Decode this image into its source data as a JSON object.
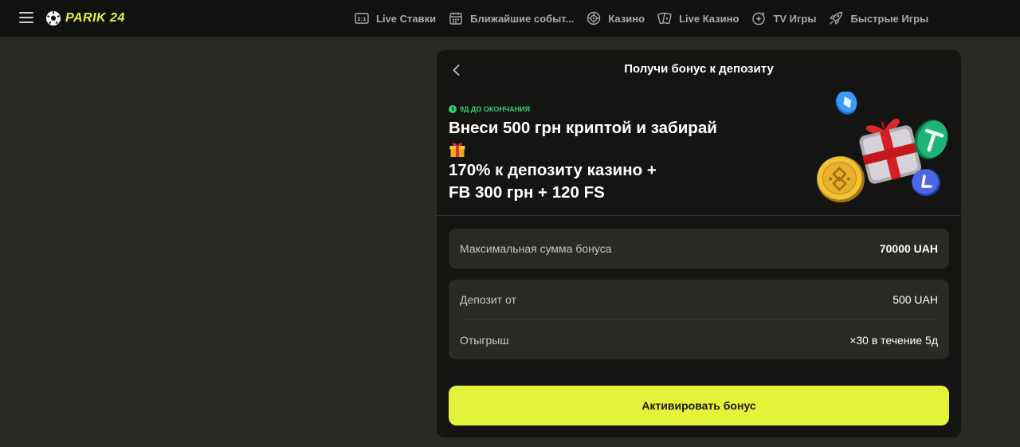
{
  "header": {
    "logo_text": "PARIK 24",
    "nav": [
      {
        "label": "Live Ставки",
        "icon": "live-bets-icon"
      },
      {
        "label": "Ближайшие событ...",
        "icon": "calendar-icon"
      },
      {
        "label": "Казино",
        "icon": "roulette-icon"
      },
      {
        "label": "Live Казино",
        "icon": "cards-icon"
      },
      {
        "label": "TV Игры",
        "icon": "tv-games-icon"
      },
      {
        "label": "Быстрые Игры",
        "icon": "rocket-icon"
      }
    ]
  },
  "panel": {
    "title": "Получи бонус к депозиту",
    "deadline": "9Д ДО ОКОНЧАНИЯ",
    "promo_line1": "Внеси 500 грн криптой и забирай",
    "promo_line2": "170% к депозиту казино +",
    "promo_line3": "FB 300 грн + 120 FS",
    "max_bonus": {
      "label": "Максимальная сумма бонуса",
      "value": "70000 UAH"
    },
    "deposit": {
      "label": "Депозит от",
      "value": "500 UAH"
    },
    "wager": {
      "label": "Отыгрыш",
      "value": "×30 в течение 5д"
    },
    "cta_label": "Активировать бонус"
  },
  "colors": {
    "accent": "#e4f33a",
    "background": "#2b2925",
    "topbar": "#111110",
    "panel": "#141413",
    "card": "#2a2926",
    "deadline_green": "#3ccf6e"
  }
}
